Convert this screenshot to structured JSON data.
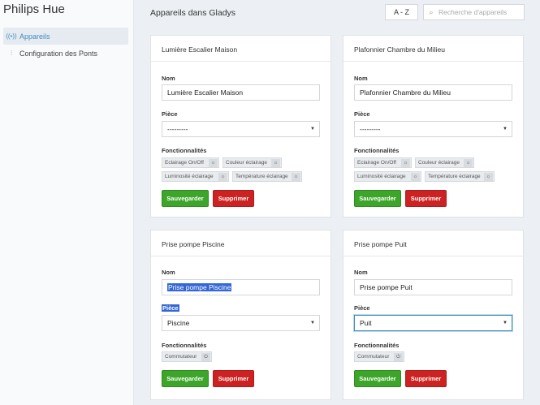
{
  "sidebar": {
    "brand": "Philips Hue",
    "items": [
      {
        "label": "Appareils",
        "icon": "broadcast-icon"
      },
      {
        "label": "Configuration des Ponts",
        "icon": "sliders-icon"
      }
    ]
  },
  "header": {
    "title": "Appareils dans Gladys",
    "sort_label": "A - Z",
    "search_placeholder": "Recherche d'appareils"
  },
  "labels": {
    "name": "Nom",
    "room": "Pièce",
    "features": "Fonctionnalités",
    "save": "Sauvegarder",
    "delete": "Supprimer"
  },
  "colors": {
    "accent": "#3c8dbc",
    "save": "#3ca52a",
    "delete": "#cc2222"
  },
  "devices": [
    {
      "title": "Lumière Escalier Maison",
      "name": "Lumière Escalier Maison",
      "room": "---------",
      "features": [
        "Eclairage On/Off",
        "Couleur éclairage",
        "Luminosité éclairage",
        "Température éclairage"
      ]
    },
    {
      "title": "Plafonnier Chambre du Milieu",
      "name": "Plafonnier Chambre du Milieu",
      "room": "---------",
      "features": [
        "Eclairage On/Off",
        "Couleur éclairage",
        "Luminosité éclairage",
        "Température éclairage"
      ]
    },
    {
      "title": "Prise pompe Piscine",
      "name": "Prise pompe Piscine",
      "room": "Piscine",
      "features": [
        "Commutateur"
      ]
    },
    {
      "title": "Prise pompe Puit",
      "name": "Prise pompe Puit",
      "room": "Puit",
      "features": [
        "Commutateur"
      ]
    }
  ]
}
